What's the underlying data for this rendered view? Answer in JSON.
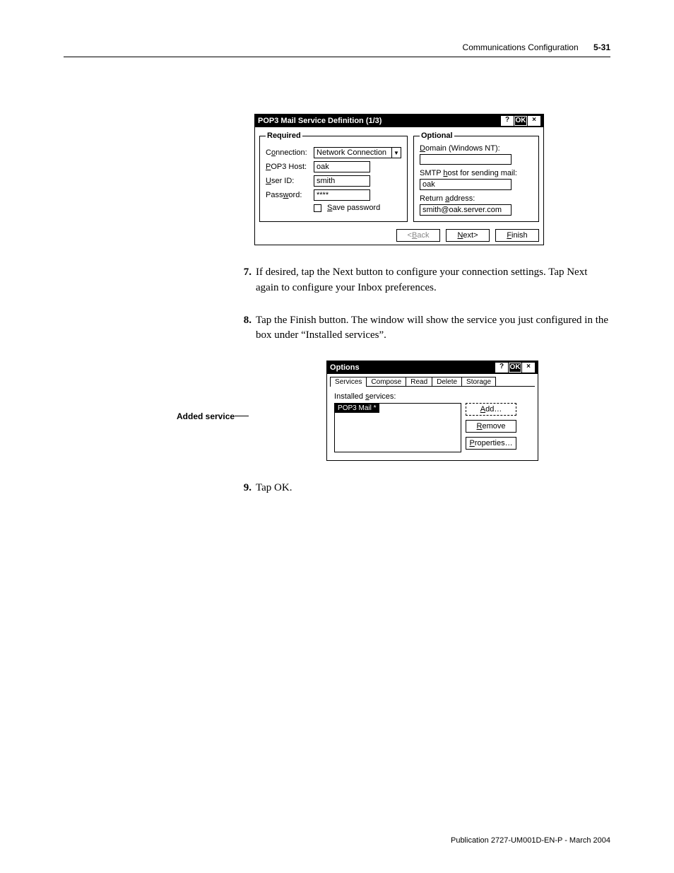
{
  "header": {
    "section": "Communications Configuration",
    "page": "5-31"
  },
  "dialog1": {
    "title": "POP3 Mail Service Definition (1/3)",
    "helpBtn": "?",
    "okBtn": "OK",
    "closeBtn": "×",
    "required": {
      "legend": "Required",
      "connectionLabel": "Connection:",
      "connectionValue": "Network Connection",
      "hostLabel": "POP3 Host:",
      "hostValue": "oak",
      "userLabel": "User ID:",
      "userValue": "smith",
      "passLabel": "Password:",
      "passValue": "****",
      "saveLabel": "Save password"
    },
    "optional": {
      "legend": "Optional",
      "domainLabel": "Domain (Windows NT):",
      "domainValue": "",
      "smtpLabel": "SMTP host for sending mail:",
      "smtpValue": "oak",
      "returnLabel": "Return address:",
      "returnValue": "smith@oak.server.com"
    },
    "buttons": {
      "back": "<Back",
      "next": "Next>",
      "finish": "Finish"
    }
  },
  "steps": {
    "s7num": "7.",
    "s7": "If desired, tap the Next button to configure your connection settings. Tap Next again to configure your Inbox preferences.",
    "s8num": "8.",
    "s8": "Tap the Finish button. The window will show the service you just configured in the box under “Installed services”.",
    "s9num": "9.",
    "s9": "Tap OK."
  },
  "callout": "Added service",
  "dialog2": {
    "title": "Options",
    "helpBtn": "?",
    "okBtn": "OK",
    "closeBtn": "×",
    "tabs": [
      "Services",
      "Compose",
      "Read",
      "Delete",
      "Storage"
    ],
    "installedLabel": "Installed services:",
    "listItem": "POP3 Mail *",
    "buttons": {
      "add": "Add…",
      "remove": "Remove",
      "properties": "Properties…"
    }
  },
  "footer": "Publication 2727-UM001D-EN-P - March 2004"
}
